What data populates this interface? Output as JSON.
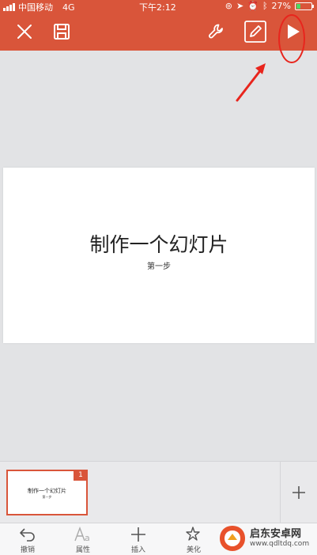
{
  "status_bar": {
    "carrier": "中国移动",
    "network": "4G",
    "time": "下午2:12",
    "battery_percent": "27%",
    "battery_level": 0.27
  },
  "toolbar": {
    "close_icon": "close-icon",
    "save_icon": "save-icon",
    "tools_icon": "wrench-icon",
    "edit_icon": "pencil-icon",
    "play_icon": "play-icon"
  },
  "slide": {
    "title": "制作一个幻灯片",
    "subtitle": "第一步"
  },
  "thumbnails": [
    {
      "number": "1",
      "title": "制作一个幻灯片",
      "subtitle": "第一步"
    }
  ],
  "tabs": [
    {
      "label": "撤销",
      "icon": "undo-icon"
    },
    {
      "label": "属性",
      "icon": "font-icon"
    },
    {
      "label": "插入",
      "icon": "plus-icon"
    },
    {
      "label": "美化",
      "icon": "magic-icon"
    }
  ],
  "watermark": {
    "name": "启东安卓网",
    "url": "www.qdltdq.com"
  },
  "colors": {
    "brand": "#d9553a",
    "annotation": "#e8251d"
  }
}
